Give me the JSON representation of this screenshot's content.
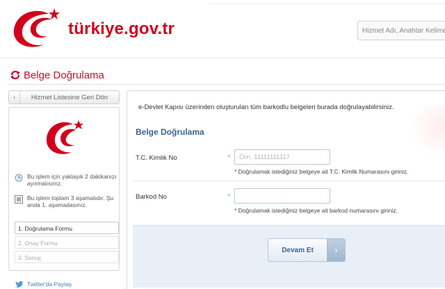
{
  "header": {
    "brand": "türkiye.gov.tr",
    "search_placeholder": "Hizmet Adı, Anahtar Kelime,"
  },
  "page": {
    "title": "Belge Doğrulama"
  },
  "left": {
    "back_label": "Hizmet Listesine Geri Dön",
    "info_time": "Bu işlem için yaklaşık 2 dakikanızı ayırmalısınız.",
    "info_steps": "Bu işlem toplam 3 aşamalıdır. Şu anda 1. aşamadasınız.",
    "steps": [
      "1. Doğrulama Formu",
      "2. Onay Formu",
      "3. Sonuç"
    ],
    "twitter": "Twitter'da Paylaş"
  },
  "main": {
    "intro": "e-Devlet Kapısı üzerinden oluşturulan tüm barkodlu belgeleri burada doğrulayabilirsiniz.",
    "form_title": "Belge Doğrulama",
    "tc_label": "T.C. Kimlik No",
    "tc_placeholder": "Örn. 11111111117",
    "tc_hint": "* Doğrulamak istediğiniz belgeye ait T.C. Kimlik Numarasını giriniz.",
    "barkod_label": "Barkod No",
    "barkod_value": "",
    "barkod_hint": "* Doğrulamak istediğiniz belgeye ait barkod numarasını giriniz.",
    "required_mark": "*",
    "submit_label": "Devam Et",
    "submit_arrow": "›"
  },
  "colors": {
    "brand_red": "#d3001c",
    "title_blue": "#3a6592",
    "panel_blue": "#e8eff7"
  }
}
